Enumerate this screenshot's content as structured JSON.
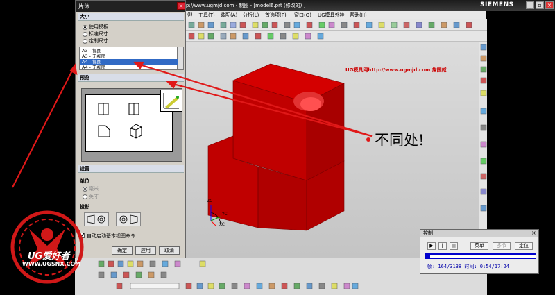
{
  "window": {
    "title": "http://www.ugmjd.com - 制图 - [model6.prt  (修改的)  ]",
    "brand": "SIEMENS"
  },
  "menu": [
    "(I)",
    "工具(T)",
    "装配(A)",
    "分析(L)",
    "首选项(P)",
    "窗口(O)",
    "UG模具外挂",
    "帮助(H)"
  ],
  "dialog": {
    "title": "片体",
    "size_section": "大小",
    "size_options": [
      {
        "label": "使用模板",
        "selected": true
      },
      {
        "label": "标准尺寸",
        "selected": false
      },
      {
        "label": "定制尺寸",
        "selected": false
      }
    ],
    "template_list": [
      {
        "label": "A3 - 视图",
        "selected": false
      },
      {
        "label": "A3 - 无视图",
        "selected": false
      },
      {
        "label": "A4 - 视图",
        "selected": true
      },
      {
        "label": "A4 - 无视图",
        "selected": false
      }
    ],
    "preview_section": "预览",
    "settings_section": "设置",
    "units_label": "单位",
    "units_options": [
      {
        "label": "毫米",
        "selected": true
      },
      {
        "label": "英寸",
        "selected": false
      }
    ],
    "projection_label": "投影",
    "auto_start_label": "自动启动基本视图命令",
    "auto_start_checked": true,
    "buttons": {
      "ok": "确定",
      "apply": "应用",
      "cancel": "取消"
    }
  },
  "viewport": {
    "watermark": "UG模具网http://www.ugmjd.com 詹国威",
    "annotation": "不同处!",
    "triad": {
      "z": "ZC",
      "y": "YC",
      "x": "XC"
    }
  },
  "control_panel": {
    "title": "控制",
    "close": "×",
    "buttons": {
      "menu": "菜单",
      "multi": "多节",
      "locate": "定位"
    },
    "info": "帧: 164/3138 时间: 0:54/17:24",
    "progress_fraction": 0.052
  },
  "logo": {
    "name": "UG爱好者",
    "site": "WWW.UGSNX.COM"
  },
  "colors": {
    "model_red": "#c00000",
    "arrow_red": "#e01818",
    "selection_blue": "#316ac5",
    "dialog_bg": "#d4d0c8"
  }
}
